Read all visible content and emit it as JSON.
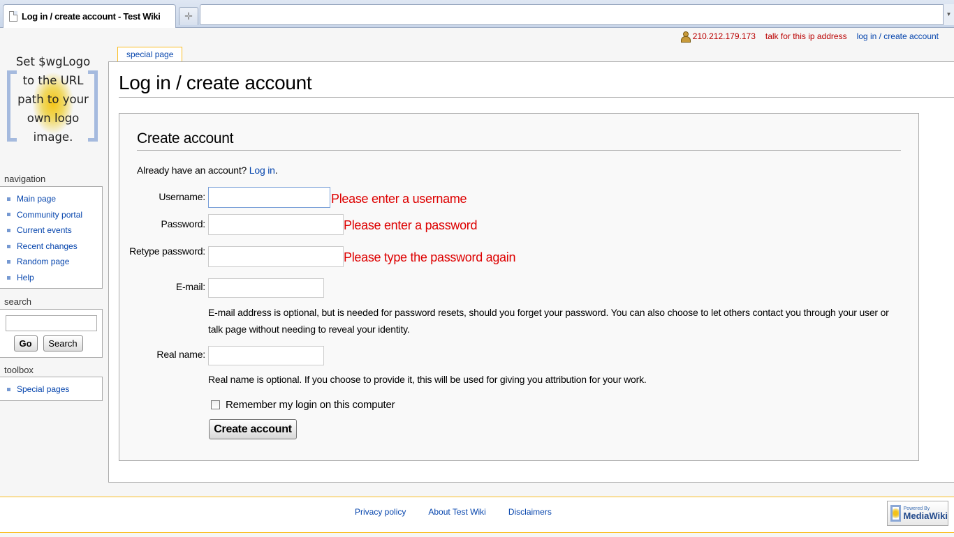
{
  "browser": {
    "tab_title": "Log in / create account - Test Wiki",
    "new_tab_symbol": "✛",
    "dropdown_symbol": "▼"
  },
  "personal": {
    "ip": "210.212.179.173",
    "talk": "talk for this ip address",
    "login": "log in / create account"
  },
  "logo": {
    "text": "Set $wgLogo\nto the URL\npath to your\nown logo\nimage."
  },
  "sidebar": {
    "navigation_heading": "navigation",
    "navigation": [
      {
        "label": "Main page"
      },
      {
        "label": "Community portal"
      },
      {
        "label": "Current events"
      },
      {
        "label": "Recent changes"
      },
      {
        "label": "Random page"
      },
      {
        "label": "Help"
      }
    ],
    "search_heading": "search",
    "go_label": "Go",
    "search_label": "Search",
    "toolbox_heading": "toolbox",
    "toolbox": [
      {
        "label": "Special pages"
      }
    ]
  },
  "page_tab": "special page",
  "content": {
    "title": "Log in / create account",
    "form_heading": "Create account",
    "already_text": "Already have an account?",
    "login_link": "Log in",
    "already_end": ".",
    "username_label": "Username:",
    "username_value": "",
    "username_error": "Please enter a username",
    "password_label": "Password:",
    "password_value": "",
    "password_error": "Please enter a password",
    "retype_label": "Retype password:",
    "retype_value": "",
    "retype_error": "Please type the password again",
    "email_label": "E-mail:",
    "email_value": "",
    "email_help": "E-mail address is optional, but is needed for password resets, should you forget your password. You can also choose to let others contact you through your user or talk page without needing to reveal your identity.",
    "realname_label": "Real name:",
    "realname_value": "",
    "realname_help": "Real name is optional. If you choose to provide it, this will be used for giving you attribution for your work.",
    "remember_label": "Remember my login on this computer",
    "create_button": "Create account"
  },
  "footer": {
    "links": [
      "Privacy policy",
      "About Test Wiki",
      "Disclaimers"
    ],
    "powered_small": "Powered By",
    "powered_big": "MediaWiki"
  },
  "colors": {
    "link": "#0645ad",
    "error": "#dd0000",
    "accent_border": "#fabd23"
  }
}
